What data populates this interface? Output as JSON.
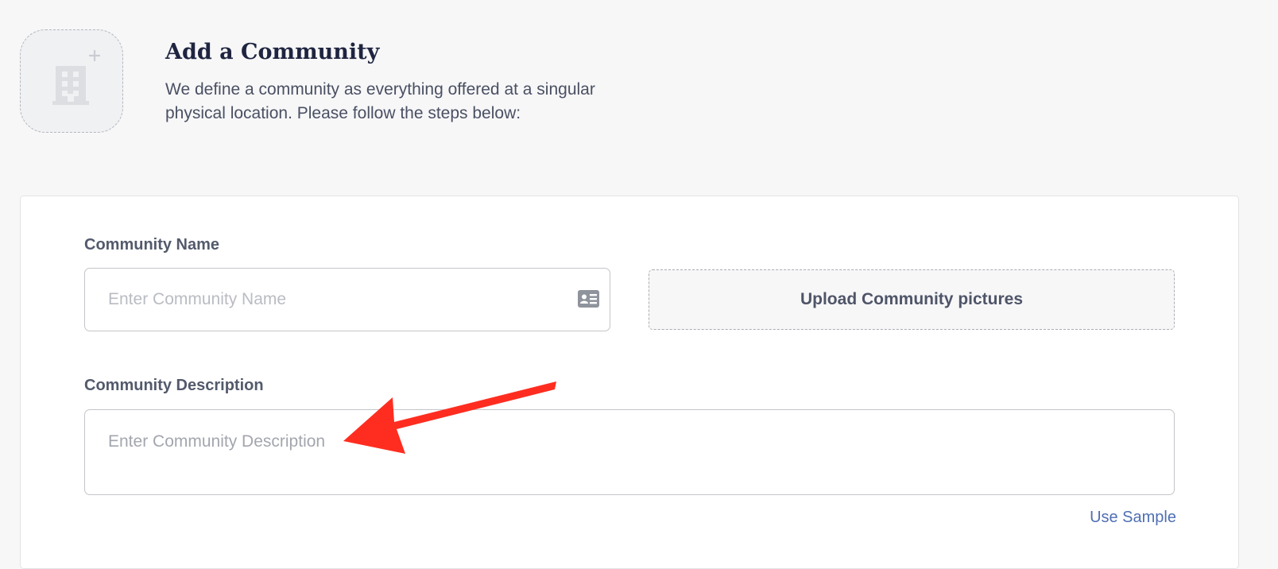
{
  "header": {
    "title": "Add a Community",
    "subtitle": "We define a community as everything offered at a singular physical location. Please follow the steps below:"
  },
  "form": {
    "name_label": "Community Name",
    "name_placeholder": "Enter Community Name",
    "upload_label": "Upload Community pictures",
    "description_label": "Community Description",
    "description_placeholder": "Enter Community Description",
    "use_sample_label": "Use Sample"
  },
  "icons": {
    "avatar": "building-icon",
    "avatar_badge": "plus-icon",
    "name_field": "id-card-icon"
  },
  "colors": {
    "title": "#1f2540",
    "link": "#4f6fb3",
    "annotation_arrow": "#ff2d20",
    "background": "#f7f7f8"
  }
}
